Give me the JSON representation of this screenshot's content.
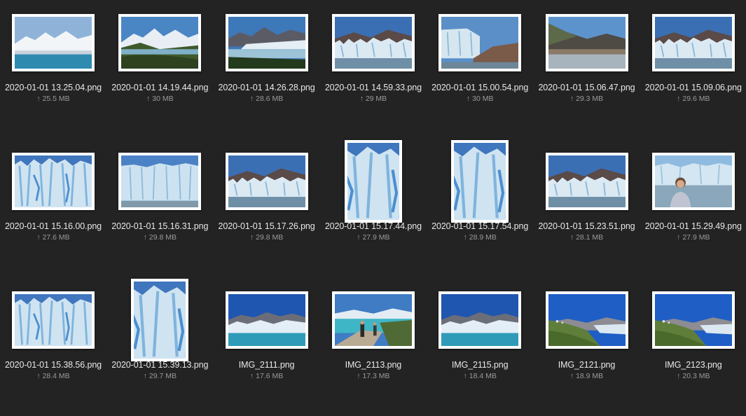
{
  "files": [
    {
      "name": "2020-01-01 13.25.04.png",
      "size": "25.5 MB",
      "orientation": "landscape",
      "scene": "lake-mountains",
      "upload_icon": "upload-arrow-icon"
    },
    {
      "name": "2020-01-01 14.19.44.png",
      "size": "30 MB",
      "orientation": "landscape",
      "scene": "valley-mountains",
      "upload_icon": "upload-arrow-icon"
    },
    {
      "name": "2020-01-01 14.26.28.png",
      "size": "28.6 MB",
      "orientation": "landscape",
      "scene": "glacier-lake-wide",
      "upload_icon": "upload-arrow-icon"
    },
    {
      "name": "2020-01-01 14.59.33.png",
      "size": "29 MB",
      "orientation": "landscape",
      "scene": "glacier-front",
      "upload_icon": "upload-arrow-icon"
    },
    {
      "name": "2020-01-01 15.00.54.png",
      "size": "30 MB",
      "orientation": "landscape",
      "scene": "glacier-rocks",
      "upload_icon": "upload-arrow-icon"
    },
    {
      "name": "2020-01-01 15.06.47.png",
      "size": "29.3 MB",
      "orientation": "landscape",
      "scene": "mountain-shore",
      "upload_icon": "upload-arrow-icon"
    },
    {
      "name": "2020-01-01 15.09.06.png",
      "size": "29.6 MB",
      "orientation": "landscape",
      "scene": "glacier-front",
      "upload_icon": "upload-arrow-icon"
    },
    {
      "name": "2020-01-01 15.16.00.png",
      "size": "27.6 MB",
      "orientation": "landscape",
      "scene": "ice-closeup",
      "upload_icon": "upload-arrow-icon"
    },
    {
      "name": "2020-01-01 15.16.31.png",
      "size": "29.8 MB",
      "orientation": "landscape",
      "scene": "ice-wall",
      "upload_icon": "upload-arrow-icon"
    },
    {
      "name": "2020-01-01 15.17.26.png",
      "size": "29.8 MB",
      "orientation": "landscape",
      "scene": "glacier-front",
      "upload_icon": "upload-arrow-icon"
    },
    {
      "name": "2020-01-01 15.17.44.png",
      "size": "27.9 MB",
      "orientation": "portrait",
      "scene": "ice-closeup",
      "upload_icon": "upload-arrow-icon"
    },
    {
      "name": "2020-01-01 15.17.54.png",
      "size": "28.9 MB",
      "orientation": "portrait",
      "scene": "ice-closeup",
      "upload_icon": "upload-arrow-icon"
    },
    {
      "name": "2020-01-01 15.23.51.png",
      "size": "28.1 MB",
      "orientation": "landscape",
      "scene": "glacier-front",
      "upload_icon": "upload-arrow-icon"
    },
    {
      "name": "2020-01-01 15.29.49.png",
      "size": "27.9 MB",
      "orientation": "landscape",
      "scene": "person-glacier",
      "upload_icon": "upload-arrow-icon"
    },
    {
      "name": "2020-01-01 15.38.56.png",
      "size": "28.4 MB",
      "orientation": "landscape",
      "scene": "ice-closeup",
      "upload_icon": "upload-arrow-icon"
    },
    {
      "name": "2020-01-01 15.39.13.png",
      "size": "29.7 MB",
      "orientation": "portrait",
      "scene": "ice-closeup",
      "upload_icon": "upload-arrow-icon"
    },
    {
      "name": "IMG_2111.png",
      "size": "17.6 MB",
      "orientation": "landscape",
      "scene": "glacier-lake-blue",
      "upload_icon": "upload-arrow-icon"
    },
    {
      "name": "IMG_2113.png",
      "size": "17.3 MB",
      "orientation": "landscape",
      "scene": "boardwalk",
      "upload_icon": "upload-arrow-icon"
    },
    {
      "name": "IMG_2115.png",
      "size": "18.4 MB",
      "orientation": "landscape",
      "scene": "glacier-lake-blue",
      "upload_icon": "upload-arrow-icon"
    },
    {
      "name": "IMG_2121.png",
      "size": "18.9 MB",
      "orientation": "landscape",
      "scene": "green-hills",
      "upload_icon": "upload-arrow-icon"
    },
    {
      "name": "IMG_2123.png",
      "size": "20.3 MB",
      "orientation": "landscape",
      "scene": "green-hills",
      "upload_icon": "upload-arrow-icon"
    }
  ],
  "colors": {
    "background": "#232323",
    "filename_text": "#e8e8e8",
    "size_text": "#9a9a9a",
    "frame": "#ffffff"
  }
}
